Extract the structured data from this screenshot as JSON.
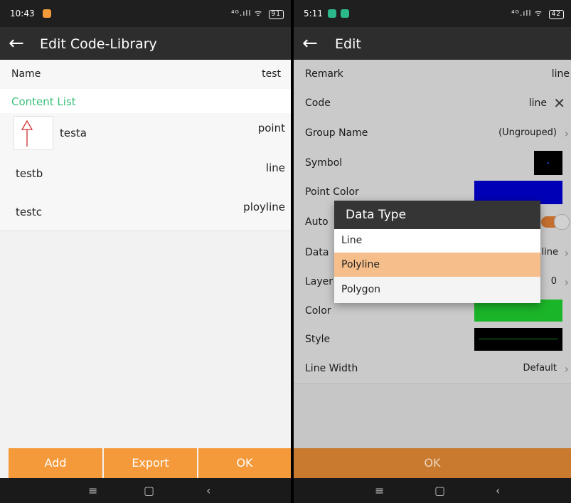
{
  "left": {
    "status": {
      "time": "10:43",
      "signal": "⁴ᴳ.ıll ᯤ",
      "battery": "91"
    },
    "title": "Edit Code-Library",
    "name_row": {
      "label": "Name",
      "value": "test"
    },
    "section_title": "Content List",
    "items": [
      {
        "name": "testa",
        "type": "point"
      },
      {
        "name": "testb",
        "type": "line"
      },
      {
        "name": "testc",
        "type": "ployline"
      }
    ],
    "buttons": {
      "add": "Add",
      "export": "Export",
      "ok": "OK"
    }
  },
  "right": {
    "status": {
      "time": "5:11",
      "signal": "⁴ᴳ.ıll ᯤ",
      "battery": "42"
    },
    "title": "Edit",
    "rows": {
      "remark": {
        "label": "Remark",
        "value": "line"
      },
      "code": {
        "label": "Code",
        "value": "line"
      },
      "group": {
        "label": "Group Name",
        "value": "(Ungrouped)"
      },
      "symbol": {
        "label": "Symbol"
      },
      "point_color": {
        "label": "Point Color"
      },
      "auto": {
        "label": "Auto"
      },
      "data": {
        "label": "Data",
        "value": "line"
      },
      "layer": {
        "label": "Layer",
        "value": "0"
      },
      "color": {
        "label": "Color"
      },
      "style": {
        "label": "Style"
      },
      "line_width": {
        "label": "Line Width",
        "value": "Default"
      }
    },
    "dialog": {
      "title": "Data Type",
      "options": [
        {
          "label": "Line",
          "selected": false
        },
        {
          "label": "Polyline",
          "selected": true
        },
        {
          "label": "Polygon",
          "selected": false
        }
      ]
    },
    "ok": "OK"
  },
  "colors": {
    "accent": "#f59a3a",
    "section_green": "#3bbf7a",
    "point_color": "#0000e0",
    "line_color": "#22dd33",
    "selected_option": "#f6be8a"
  },
  "icons": {
    "back": "arrow-left-icon",
    "clear": "close-icon",
    "chevron": "chevron-right-icon",
    "menu": "menu-icon",
    "home": "home-icon",
    "back_nav": "nav-back-icon"
  }
}
